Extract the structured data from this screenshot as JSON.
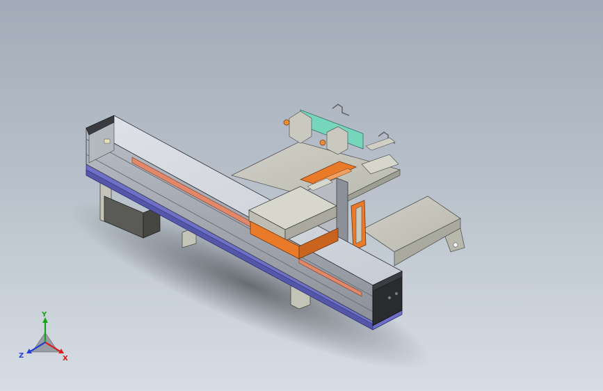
{
  "triad": {
    "x_label": "X",
    "y_label": "Y",
    "z_label": "Z",
    "colors": {
      "x": "#d62020",
      "y": "#19a319",
      "z": "#2440d6"
    }
  },
  "colors": {
    "background_top": "#a2acb8",
    "background_bottom": "#d7dde4",
    "aluminum": "#c8ccd3",
    "carriage_orange": "#e87a2a",
    "base_plate_blue": "#6e70c8",
    "support_grey": "#c3c3b8",
    "pcb_teal": "#75d6bc"
  }
}
